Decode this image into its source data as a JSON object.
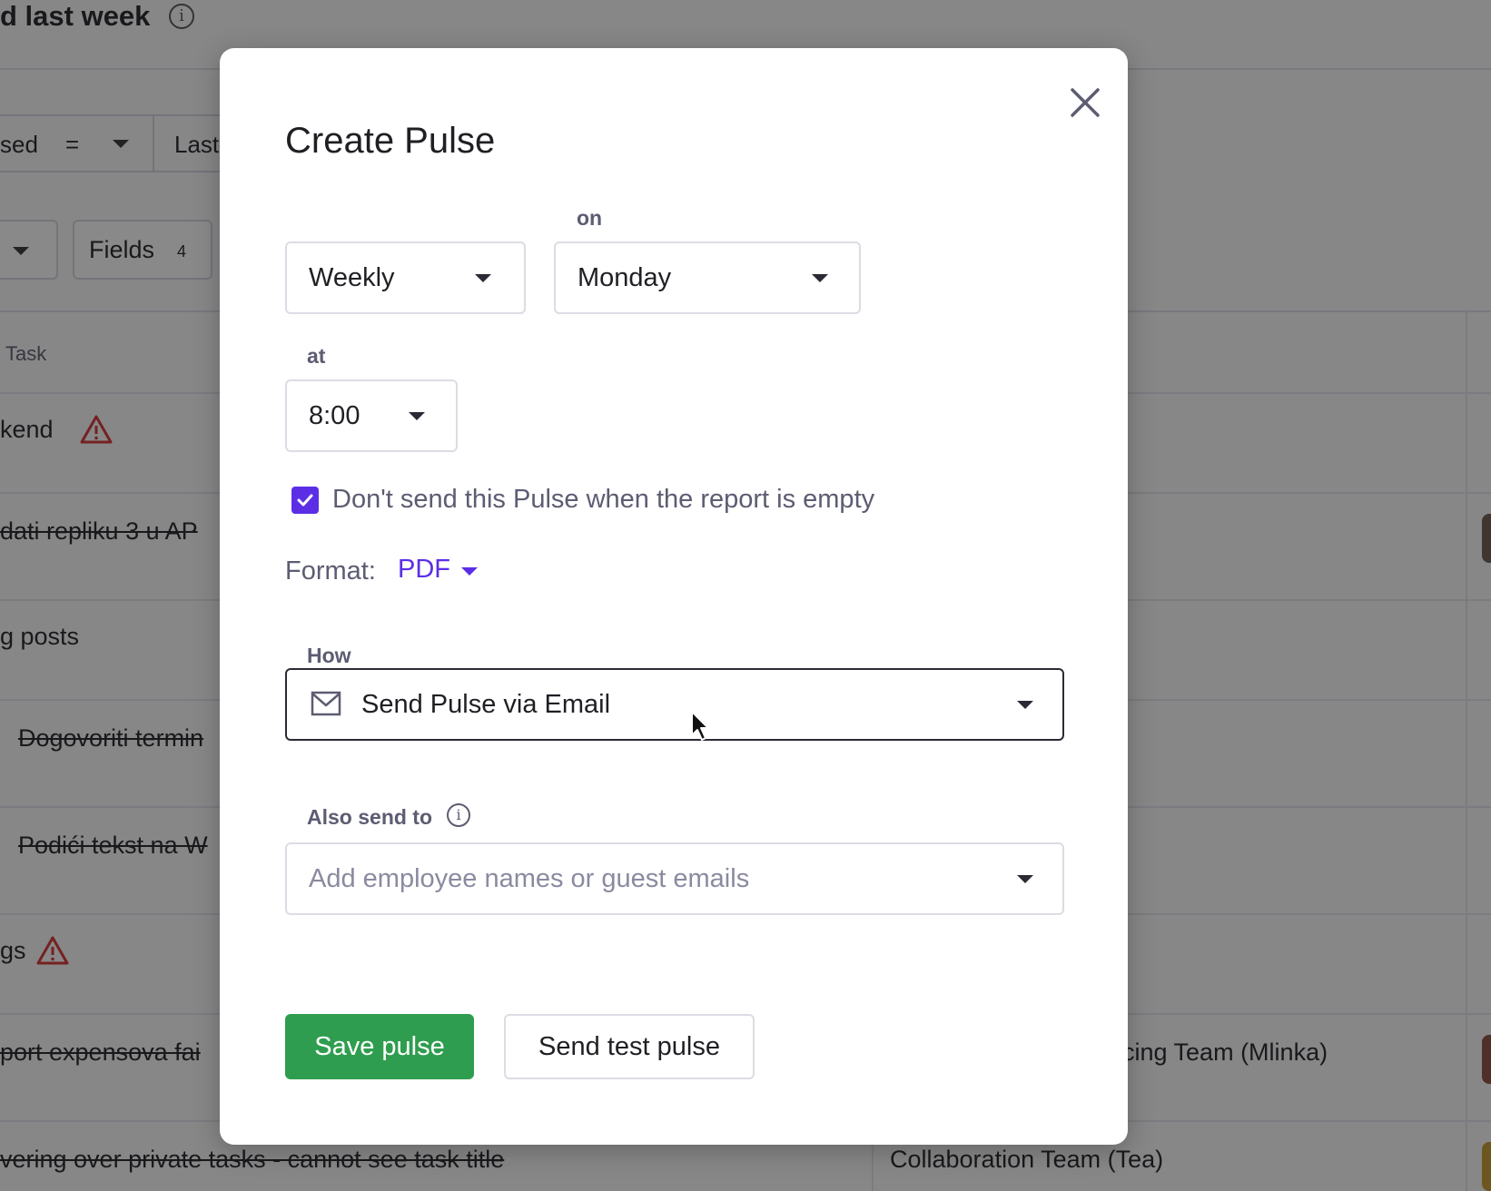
{
  "background": {
    "page_title": "d last week",
    "filter_field": "sed",
    "filter_operator": "=",
    "filter_value": "Last",
    "fields_button": "Fields",
    "fields_count": "4",
    "column_task": "Task",
    "rows": [
      {
        "task": "kend",
        "struck": false,
        "warning": true
      },
      {
        "task": "dati repliku 3 u AP",
        "struck": true,
        "warning": false
      },
      {
        "task": "g posts",
        "struck": false,
        "warning": false
      },
      {
        "task": "Dogovoriti termin",
        "struck": true,
        "warning": false
      },
      {
        "task": "Podići tekst na W",
        "struck": true,
        "warning": false
      },
      {
        "task": "gs",
        "struck": false,
        "warning": true
      },
      {
        "task": "port expensova fai",
        "struck": true,
        "warning": false,
        "team": "cing Team (Mlinka)"
      },
      {
        "task": "vering over private tasks - cannot see task title",
        "struck": true,
        "warning": false,
        "team": "Collaboration Team (Tea)"
      }
    ]
  },
  "modal": {
    "title": "Create Pulse",
    "close_icon": "close-icon",
    "frequency": {
      "value": "Weekly"
    },
    "day": {
      "label": "on",
      "value": "Monday"
    },
    "time": {
      "label": "at",
      "value": "8:00"
    },
    "skip_empty": {
      "checked": true,
      "label": "Don't send this Pulse when the report is empty"
    },
    "format": {
      "label": "Format:",
      "value": "PDF"
    },
    "how": {
      "label": "How",
      "value": "Send Pulse via Email",
      "icon": "mail-icon"
    },
    "also_send_to": {
      "label": "Also send to",
      "placeholder": "Add employee names or guest emails",
      "icon": "info-icon"
    },
    "save_button": "Save pulse",
    "test_button": "Send test pulse"
  },
  "colors": {
    "accent": "#5b2ee6",
    "primary_button": "#2f9d4f",
    "warning": "#d62f2f"
  }
}
